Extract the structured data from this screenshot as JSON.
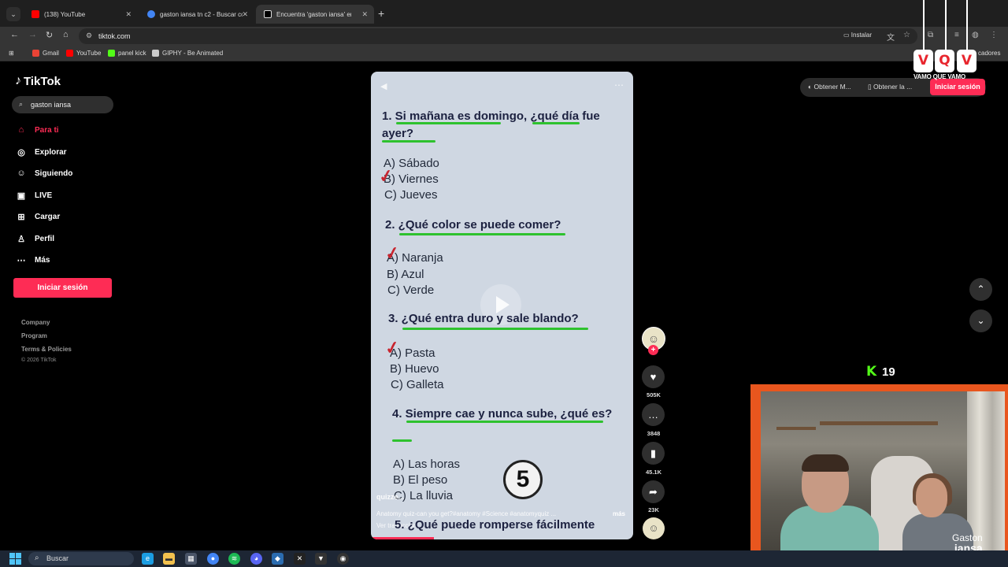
{
  "browser": {
    "tabs": [
      {
        "title": "(138) YouTube",
        "favicon": "youtube-icon",
        "color": "#ff0000"
      },
      {
        "title": "gaston iansa tn c2 - Buscar con",
        "favicon": "google-icon",
        "color": "#4285f4"
      },
      {
        "title": "Encuentra 'gaston iansa' en",
        "favicon": "tiktok-icon",
        "color": "#ffffff"
      }
    ],
    "url": "tiktok.com",
    "install_label": "Instalar",
    "bookmarks": [
      {
        "label": "Gmail",
        "icon": "gmail-icon",
        "color": "#ea4335"
      },
      {
        "label": "YouTube",
        "icon": "youtube-icon",
        "color": "#ff0000"
      },
      {
        "label": "panel kick",
        "icon": "kick-icon",
        "color": "#53fc18"
      },
      {
        "label": "GIPHY - Be Animated",
        "icon": "page-icon",
        "color": "#cccccc"
      }
    ],
    "bookmarks_more": "cadores"
  },
  "tiktok": {
    "logo": "TikTok",
    "search_value": "gaston iansa",
    "nav": [
      {
        "label": "Para ti",
        "icon": "home-icon",
        "glyph": "⌂",
        "active": true
      },
      {
        "label": "Explorar",
        "icon": "compass-icon",
        "glyph": "◎",
        "active": false
      },
      {
        "label": "Siguiendo",
        "icon": "following-icon",
        "glyph": "☺",
        "active": false
      },
      {
        "label": "LIVE",
        "icon": "live-icon",
        "glyph": "▣",
        "active": false
      },
      {
        "label": "Cargar",
        "icon": "upload-icon",
        "glyph": "⊞",
        "active": false
      },
      {
        "label": "Perfil",
        "icon": "profile-icon",
        "glyph": "♙",
        "active": false
      },
      {
        "label": "Más",
        "icon": "more-icon",
        "glyph": "⋯",
        "active": false
      }
    ],
    "login_label": "Iniciar sesión",
    "footer_links": [
      "Company",
      "Program",
      "Terms & Policies"
    ],
    "copyright": "© 2026 TikTok",
    "top_buttons": [
      "Obtener M...",
      "Obtener la ..."
    ],
    "top_login": "Iniciar sesión"
  },
  "overlay": {
    "letters": [
      "V",
      "Q",
      "V"
    ],
    "tagline": "VAMO QUE VAMO"
  },
  "video": {
    "questions": [
      {
        "q": "1. Si mañana es domingo, ¿qué día fue ayer?",
        "options": [
          "A) Sábado",
          "B) Viernes",
          "C) Jueves"
        ],
        "checked": 1
      },
      {
        "q": "2. ¿Qué color se puede comer?",
        "options": [
          "A) Naranja",
          "B) Azul",
          "C) Verde"
        ],
        "checked": 0
      },
      {
        "q": "3. ¿Qué entra duro y sale blando?",
        "options": [
          "A) Pasta",
          "B) Huevo",
          "C) Galleta"
        ],
        "checked": 0
      },
      {
        "q": "4. Siempre cae y nunca sube, ¿qué es?",
        "options": [
          "A) Las horas",
          "B) El peso",
          "C) La lluvia"
        ],
        "checked": -1
      },
      {
        "q": "5. ¿Qué puede romperse fácilmente"
      }
    ],
    "timer": "5",
    "username": "quizze...",
    "description": "Anatomy quiz-can you get?#anatomy #Science #anatomyquiz ...",
    "more": "más",
    "translation": "Ver traducción",
    "progress": 0.24
  },
  "actions": {
    "likes": "505K",
    "comments": "3848",
    "saves": "45.1K",
    "shares": "23K"
  },
  "stream": {
    "kick_viewers": "19",
    "name_line1": "Gaston",
    "name_line2": "iansa"
  },
  "taskbar": {
    "search_placeholder": "Buscar",
    "apps": [
      {
        "name": "edge-icon",
        "color": "#1b9de2",
        "glyph": "e"
      },
      {
        "name": "folder-icon",
        "color": "#f2c14e",
        "glyph": "▬"
      },
      {
        "name": "store-icon",
        "color": "#4a5568",
        "glyph": "▦"
      },
      {
        "name": "chrome-icon",
        "color": "#4285f4",
        "glyph": "●"
      },
      {
        "name": "spotify-icon",
        "color": "#1db954",
        "glyph": "≋"
      },
      {
        "name": "discord-icon",
        "color": "#5865f2",
        "glyph": "◕"
      },
      {
        "name": "app-icon",
        "color": "#2b6cb0",
        "glyph": "◆"
      },
      {
        "name": "capcut-icon",
        "color": "#222222",
        "glyph": "✕"
      },
      {
        "name": "shield-icon",
        "color": "#333333",
        "glyph": "▼"
      },
      {
        "name": "obs-icon",
        "color": "#333333",
        "glyph": "◉"
      }
    ]
  }
}
